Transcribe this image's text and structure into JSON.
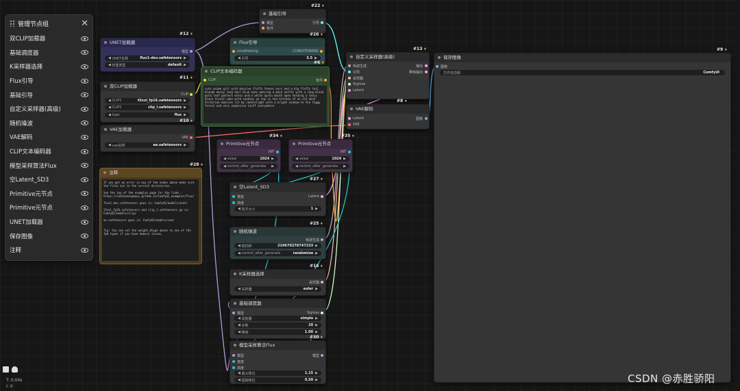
{
  "panel": {
    "title": "管理节点组",
    "items": [
      {
        "label": "双CLIP加载器"
      },
      {
        "label": "基础调度器"
      },
      {
        "label": "K采样器选择"
      },
      {
        "label": "Flux引导"
      },
      {
        "label": "基础引导"
      },
      {
        "label": "自定义采样器(高级)"
      },
      {
        "label": "随机噪波"
      },
      {
        "label": "VAE解码"
      },
      {
        "label": "CLIP文本编码器"
      },
      {
        "label": "模型采样算法Flux"
      },
      {
        "label": "空Latent_SD3"
      },
      {
        "label": "Primitive元节点"
      },
      {
        "label": "Primitive元节点"
      },
      {
        "label": "UNET加载器"
      },
      {
        "label": "保存图像"
      },
      {
        "label": "注释"
      }
    ]
  },
  "nodes": {
    "basic_guider": {
      "title": "基础引导",
      "id": "#22",
      "in1": "模型",
      "in2": "条件",
      "out1": "引导"
    },
    "flux_guidance": {
      "title": "Flux引导",
      "id": "#26",
      "in1": "conditioning",
      "out1": "CONDITIONING",
      "w1_label": "引导",
      "w1_value": "3.5"
    },
    "unet": {
      "title": "UNET加载器",
      "id": "#12",
      "out1": "模型",
      "w1_label": "UNET名称",
      "w1_value": "flux1-dev.safetensors",
      "w2_label": "权重类型",
      "w2_value": "default"
    },
    "dual_clip": {
      "title": "双CLIP加载器",
      "id": "#11",
      "out1": "CLIP",
      "w1_label": "CLIP1",
      "w1_value": "t5xxl_fp16.safetensors",
      "w2_label": "CLIP2",
      "w2_value": "clip_l.safetensors",
      "w3_label": "type",
      "w3_value": "flux"
    },
    "vae_loader": {
      "title": "VAE加载器",
      "id": "#10",
      "out1": "VAE",
      "w1_label": "vae名称",
      "w1_value": "ae.safetensors"
    },
    "clip_text": {
      "title": "CLIP文本编码器",
      "id": "#6",
      "in1": "CLIP",
      "out1": "条件",
      "text": "cute anime girl with massive fluffy fennec ears and a big fluffy tail blonde messy long hair blue eyes wearing a maid outfit with a long black gold leaf pattern dress and a white apron mouth open holding a fancy black forest cake with candles on top in the kitchen of an old dark Victorian mansion lit by candlelight with a bright window to the foggy forest and very expensive stuff everywhere"
    },
    "sampler_custom": {
      "title": "自定义采样器(高级)",
      "id": "#13",
      "in1": "噪波生成",
      "in2": "引导",
      "in3": "采样器",
      "in4": "Sigmas",
      "in5": "Latent",
      "out1": "输出",
      "out2": "降噪输出"
    },
    "vae_decode": {
      "title": "VAE解码",
      "id": "#8",
      "in1": "Latent",
      "in2": "VAE",
      "out1": "图像"
    },
    "save_image": {
      "title": "保存图像",
      "id": "#9",
      "in1": "图像",
      "w1_label": "文件名前缀",
      "w1_value": "ComfyUI"
    },
    "note": {
      "title": "注释",
      "id": "#28",
      "text": "If you get an error in any of the nodes above make sure the files are in the correct directories.\n\nSee the top of the examples page for the links : https://comfyanonymous.github.io/ComfyUI_examples/flux/\n\nflux1-dev.safetensors goes in: ComfyUI/models/unet/\n\nt5xxl_fp16.safetensors and clip_l.safetensors go in: ComfyUI/models/clip/\n\nae.safetensors goes in: ComfyUI/models/vae/\n\n\nTip: You can set the weight_dtype above to one of the fp8 types if you have memory issues."
    },
    "prim1": {
      "title": "Primitive元节点",
      "id": "#34",
      "out1": "INT",
      "w1_label": "value",
      "w1_value": "1024",
      "w2_label": "control_after_generate",
      "w2_value": "fixed"
    },
    "prim2": {
      "title": "Primitive元节点",
      "id": "#35",
      "out1": "INT",
      "w1_label": "value",
      "w1_value": "1024",
      "w2_label": "control_after_generate",
      "w2_value": "fixed"
    },
    "empty_latent": {
      "title": "空Latent_SD3",
      "id": "#27",
      "in1": "宽度",
      "in2": "高度",
      "out1": "Latent",
      "w1_label": "批次大小",
      "w1_value": "1"
    },
    "random_noise": {
      "title": "随机噪波",
      "id": "#25",
      "out1": "噪波生成",
      "w1_label": "随机种",
      "w1_value": "219670278747233",
      "w2_label": "control_after_generate",
      "w2_value": "randomize"
    },
    "ksampler_select": {
      "title": "K采样器选择",
      "id": "#16",
      "out1": "采样器",
      "w1_label": "采样器",
      "w1_value": "euler"
    },
    "basic_scheduler": {
      "title": "基础调度器",
      "id": "#17",
      "in1": "模型",
      "out1": "Sigmas",
      "w1_label": "调度器",
      "w1_value": "simple",
      "w2_label": "步数",
      "w2_value": "20",
      "w3_label": "降噪",
      "w3_value": "1.00"
    },
    "model_sampling": {
      "title": "模型采样算法Flux",
      "id": "#30",
      "in1": "模型",
      "in2": "宽度",
      "in3": "高度",
      "out1": "模型",
      "w1_label": "最大移位",
      "w1_value": "1.15",
      "w2_label": "基础移位",
      "w2_value": "0.50"
    }
  },
  "status": {
    "line1": "T: 0.00s",
    "line2": "I: 0"
  },
  "watermark": "CSDN @赤胜骄阳",
  "colors": {
    "model": "#b39ddb",
    "clip": "#f5d742",
    "vae": "#ff6e6e",
    "latent": "#ff9cf9",
    "int": "#29c8c8",
    "guider": "#66ffff",
    "sampler": "#ecb4b4",
    "sigmas": "#cdffcd",
    "image": "#64b5f6",
    "noise": "#b0b0b0"
  }
}
